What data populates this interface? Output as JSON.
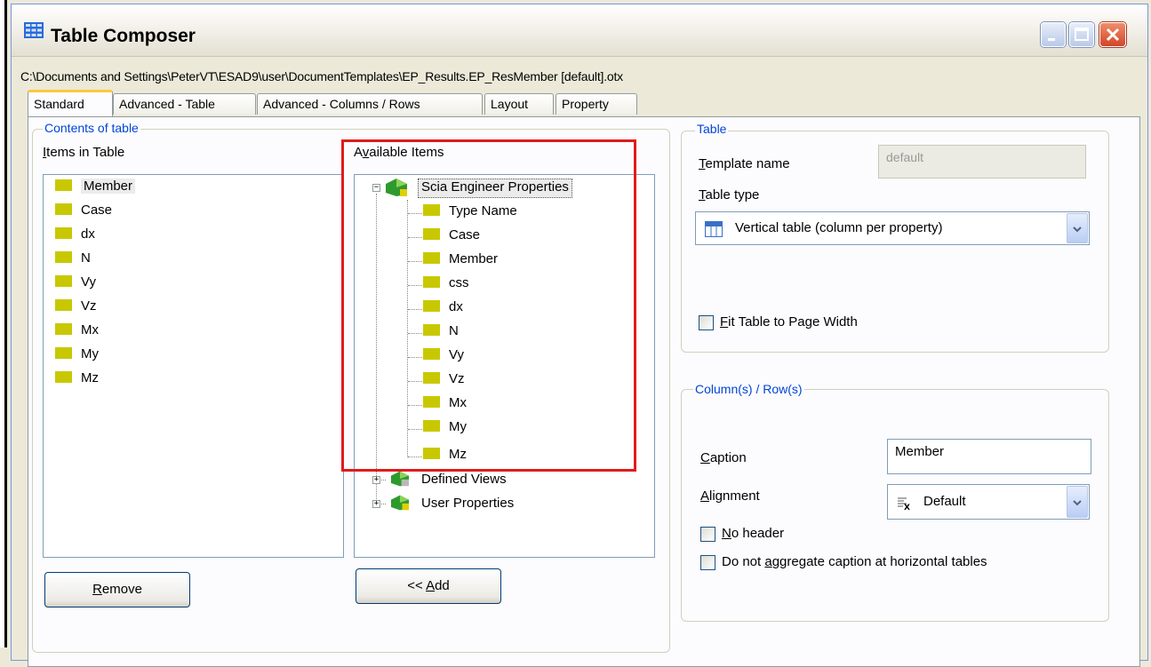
{
  "window": {
    "title": "Table Composer",
    "path": "C:\\Documents and Settings\\PeterVT\\ESAD9\\user\\DocumentTemplates\\EP_Results.EP_ResMember [default].otx"
  },
  "tabs": [
    {
      "label": "Standard",
      "active": true
    },
    {
      "label": "Advanced - Table",
      "active": false
    },
    {
      "label": "Advanced - Columns / Rows",
      "active": false
    },
    {
      "label": "Layout",
      "active": false
    },
    {
      "label": "Property",
      "active": false
    }
  ],
  "contents": {
    "group_title": "Contents of table",
    "items_label_key": "I",
    "items_label_rest": "tems in Table",
    "items": [
      "Member",
      "Case",
      "dx",
      "N",
      "Vy",
      "Vz",
      "Mx",
      "My",
      "Mz"
    ],
    "selected_index": 0,
    "remove_key": "R",
    "remove_rest": "emove"
  },
  "available": {
    "label_pre": "A",
    "label_key": "v",
    "label_rest": "ailable Items",
    "tree": {
      "root": "Scia Engineer Properties",
      "children": [
        "Type Name",
        "Case",
        "Member",
        "css",
        "dx",
        "N",
        "Vy",
        "Vz",
        "Mx",
        "My",
        "Mz"
      ],
      "others": [
        "Defined Views",
        "User Properties"
      ]
    },
    "add_pre": "<< ",
    "add_key": "A",
    "add_rest": "dd"
  },
  "table": {
    "group_title": "Table",
    "template_name_key": "T",
    "template_name_rest": "emplate name",
    "template_name_value": "default",
    "table_type_key": "T",
    "table_type_rest": "able type",
    "table_type_value": "Vertical table (column per property)",
    "fit_key": "F",
    "fit_rest": "it Table to Page Width",
    "fit_checked": false
  },
  "columns": {
    "group_title": "Column(s) / Row(s)",
    "caption_key": "C",
    "caption_rest": "aption",
    "caption_value": "Member",
    "alignment_key": "A",
    "alignment_rest": "lignment",
    "alignment_value": "Default",
    "no_header_key": "N",
    "no_header_rest": "o header",
    "no_header_checked": false,
    "aggregate_pre": "Do not ",
    "aggregate_key": "a",
    "aggregate_rest": "ggregate caption at horizontal tables",
    "aggregate_checked": false
  },
  "colors": {
    "highlight": "#e01b1b",
    "item_square": "#c8c800",
    "group_title": "#0046d5",
    "active_tab_accent": "#ffc73c"
  }
}
